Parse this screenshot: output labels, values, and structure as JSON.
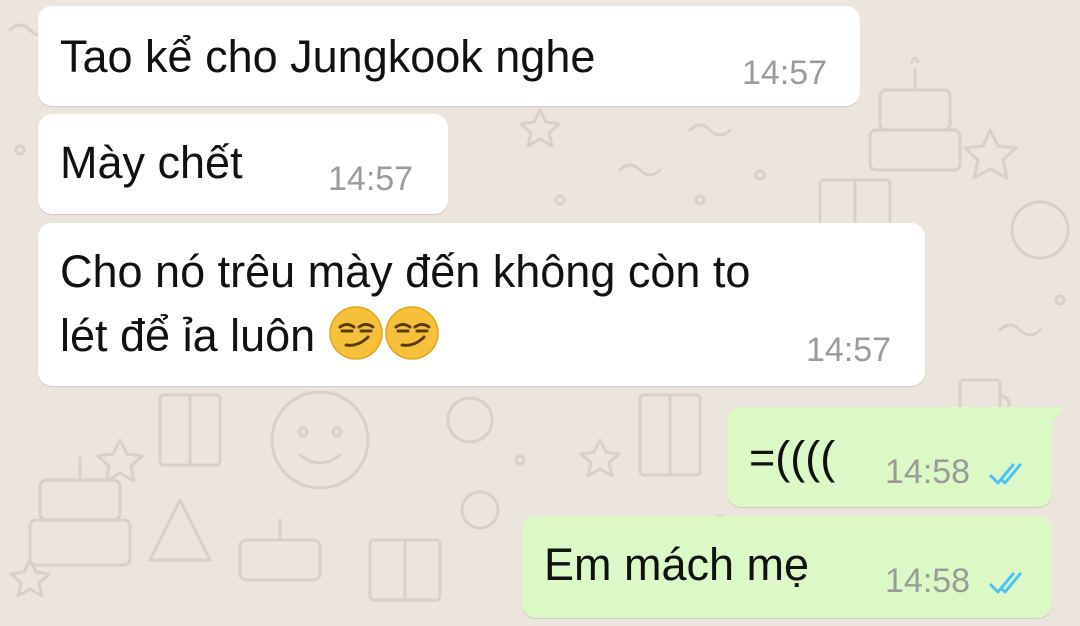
{
  "colors": {
    "wallpaper": "#ece5dd",
    "incoming_bubble": "#ffffff",
    "outgoing_bubble": "#dcf8c6",
    "text": "#111111",
    "timestamp": "#9b9b9b",
    "read_ticks": "#4fc3f7"
  },
  "messages": [
    {
      "direction": "incoming",
      "text": "Tao kể cho Jungkook nghe",
      "time": "14:57"
    },
    {
      "direction": "incoming",
      "text": "Mày chết",
      "time": "14:57"
    },
    {
      "direction": "incoming",
      "line1": "Cho nó trêu mày đến không còn to",
      "line2": "lét để ỉa luôn",
      "emojis": [
        "smirking-face",
        "smirking-face"
      ],
      "time": "14:57"
    },
    {
      "direction": "outgoing",
      "text": "=((((",
      "time": "14:58",
      "status": "read-double-check"
    },
    {
      "direction": "outgoing",
      "text": "Em mách mẹ",
      "time": "14:58",
      "status": "read-double-check"
    }
  ]
}
